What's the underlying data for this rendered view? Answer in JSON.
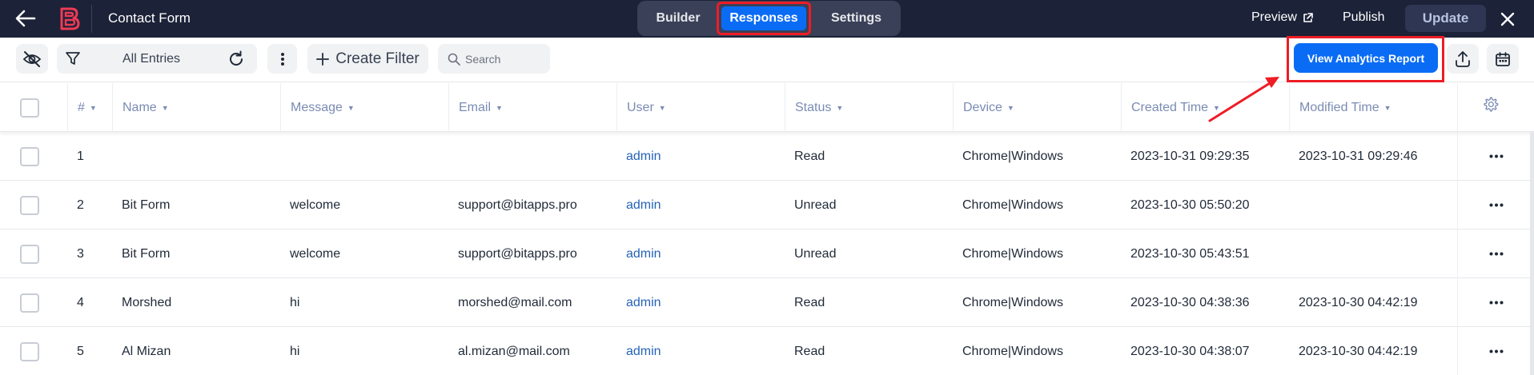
{
  "app": {
    "title": "Contact Form"
  },
  "tabs": [
    {
      "label": "Builder"
    },
    {
      "label": "Responses",
      "active": true
    },
    {
      "label": "Settings"
    }
  ],
  "header_actions": {
    "preview": "Preview",
    "publish": "Publish",
    "update": "Update"
  },
  "toolbar": {
    "entries_label": "All Entries",
    "create_filter": "Create Filter",
    "search_placeholder": "Search",
    "analytics": "View Analytics Report"
  },
  "table": {
    "columns": [
      "#",
      "Name",
      "Message",
      "Email",
      "User",
      "Status",
      "Device",
      "Created Time",
      "Modified Time"
    ],
    "rows": [
      {
        "n": "1",
        "name": "",
        "message": "",
        "email": "",
        "user": "admin",
        "status": "Read",
        "device": "Chrome|Windows",
        "created": "2023-10-31 09:29:35",
        "modified": "2023-10-31 09:29:46"
      },
      {
        "n": "2",
        "name": "Bit Form",
        "message": "welcome",
        "email": "support@bitapps.pro",
        "user": "admin",
        "status": "Unread",
        "device": "Chrome|Windows",
        "created": "2023-10-30 05:50:20",
        "modified": ""
      },
      {
        "n": "3",
        "name": "Bit Form",
        "message": "welcome",
        "email": "support@bitapps.pro",
        "user": "admin",
        "status": "Unread",
        "device": "Chrome|Windows",
        "created": "2023-10-30 05:43:51",
        "modified": ""
      },
      {
        "n": "4",
        "name": "Morshed",
        "message": "hi",
        "email": "morshed@mail.com",
        "user": "admin",
        "status": "Read",
        "device": "Chrome|Windows",
        "created": "2023-10-30 04:38:36",
        "modified": "2023-10-30 04:42:19"
      },
      {
        "n": "5",
        "name": "Al Mizan",
        "message": "hi",
        "email": "al.mizan@mail.com",
        "user": "admin",
        "status": "Read",
        "device": "Chrome|Windows",
        "created": "2023-10-30 04:38:07",
        "modified": "2023-10-30 04:42:19"
      }
    ]
  },
  "colors": {
    "topbar": "#1c2238",
    "accent": "#0a6cf5",
    "highlight": "#ee1c25",
    "header_text": "#7a8bb3",
    "link": "#2563b8"
  },
  "icons": [
    "back-arrow-icon",
    "logo-icon",
    "external-link-icon",
    "close-icon",
    "eye-off-icon",
    "filter-icon",
    "refresh-icon",
    "kebab-icon",
    "plus-icon",
    "search-icon",
    "upload-icon",
    "calendar-icon",
    "gear-icon",
    "ellipsis-icon"
  ]
}
